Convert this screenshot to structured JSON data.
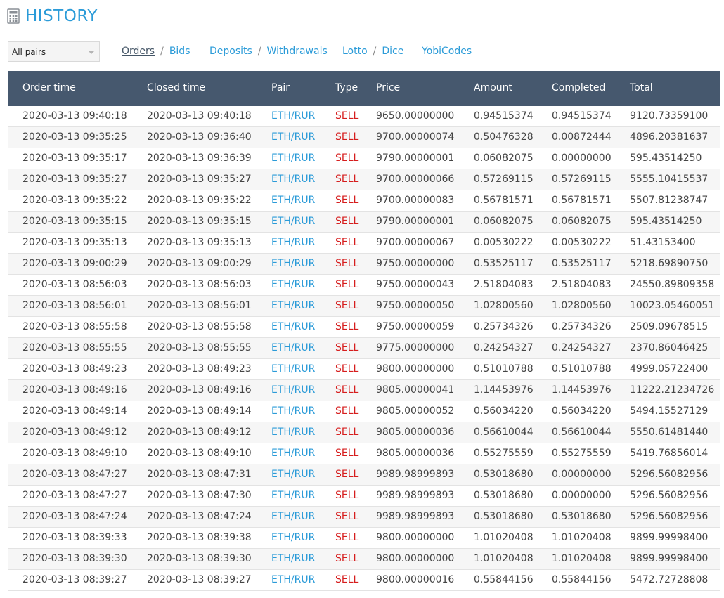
{
  "header": {
    "title": "HISTORY",
    "icon": "calculator-icon"
  },
  "filters": {
    "pair_select": "All pairs"
  },
  "nav": {
    "orders": "Orders",
    "bids": "Bids",
    "deposits": "Deposits",
    "withdrawals": "Withdrawals",
    "lotto": "Lotto",
    "dice": "Dice",
    "yobicodes": "YobiCodes",
    "separator": "/"
  },
  "columns": [
    "Order time",
    "Closed time",
    "Pair",
    "Type",
    "Price",
    "Amount",
    "Completed",
    "Total"
  ],
  "rows": [
    [
      "2020-03-13 09:40:18",
      "2020-03-13 09:40:18",
      "ETH/RUR",
      "SELL",
      "9650.00000000",
      "0.94515374",
      "0.94515374",
      "9120.73359100"
    ],
    [
      "2020-03-13 09:35:25",
      "2020-03-13 09:36:40",
      "ETH/RUR",
      "SELL",
      "9700.00000074",
      "0.50476328",
      "0.00872444",
      "4896.20381637"
    ],
    [
      "2020-03-13 09:35:17",
      "2020-03-13 09:36:39",
      "ETH/RUR",
      "SELL",
      "9790.00000001",
      "0.06082075",
      "0.00000000",
      "595.43514250"
    ],
    [
      "2020-03-13 09:35:27",
      "2020-03-13 09:35:27",
      "ETH/RUR",
      "SELL",
      "9700.00000066",
      "0.57269115",
      "0.57269115",
      "5555.10415537"
    ],
    [
      "2020-03-13 09:35:22",
      "2020-03-13 09:35:22",
      "ETH/RUR",
      "SELL",
      "9700.00000083",
      "0.56781571",
      "0.56781571",
      "5507.81238747"
    ],
    [
      "2020-03-13 09:35:15",
      "2020-03-13 09:35:15",
      "ETH/RUR",
      "SELL",
      "9790.00000001",
      "0.06082075",
      "0.06082075",
      "595.43514250"
    ],
    [
      "2020-03-13 09:35:13",
      "2020-03-13 09:35:13",
      "ETH/RUR",
      "SELL",
      "9700.00000067",
      "0.00530222",
      "0.00530222",
      "51.43153400"
    ],
    [
      "2020-03-13 09:00:29",
      "2020-03-13 09:00:29",
      "ETH/RUR",
      "SELL",
      "9750.00000000",
      "0.53525117",
      "0.53525117",
      "5218.69890750"
    ],
    [
      "2020-03-13 08:56:03",
      "2020-03-13 08:56:03",
      "ETH/RUR",
      "SELL",
      "9750.00000043",
      "2.51804083",
      "2.51804083",
      "24550.89809358"
    ],
    [
      "2020-03-13 08:56:01",
      "2020-03-13 08:56:01",
      "ETH/RUR",
      "SELL",
      "9750.00000050",
      "1.02800560",
      "1.02800560",
      "10023.05460051"
    ],
    [
      "2020-03-13 08:55:58",
      "2020-03-13 08:55:58",
      "ETH/RUR",
      "SELL",
      "9750.00000059",
      "0.25734326",
      "0.25734326",
      "2509.09678515"
    ],
    [
      "2020-03-13 08:55:55",
      "2020-03-13 08:55:55",
      "ETH/RUR",
      "SELL",
      "9775.00000000",
      "0.24254327",
      "0.24254327",
      "2370.86046425"
    ],
    [
      "2020-03-13 08:49:23",
      "2020-03-13 08:49:23",
      "ETH/RUR",
      "SELL",
      "9800.00000000",
      "0.51010788",
      "0.51010788",
      "4999.05722400"
    ],
    [
      "2020-03-13 08:49:16",
      "2020-03-13 08:49:16",
      "ETH/RUR",
      "SELL",
      "9805.00000041",
      "1.14453976",
      "1.14453976",
      "11222.21234726"
    ],
    [
      "2020-03-13 08:49:14",
      "2020-03-13 08:49:14",
      "ETH/RUR",
      "SELL",
      "9805.00000052",
      "0.56034220",
      "0.56034220",
      "5494.15527129"
    ],
    [
      "2020-03-13 08:49:12",
      "2020-03-13 08:49:12",
      "ETH/RUR",
      "SELL",
      "9805.00000036",
      "0.56610044",
      "0.56610044",
      "5550.61481440"
    ],
    [
      "2020-03-13 08:49:10",
      "2020-03-13 08:49:10",
      "ETH/RUR",
      "SELL",
      "9805.00000036",
      "0.55275559",
      "0.55275559",
      "5419.76856014"
    ],
    [
      "2020-03-13 08:47:27",
      "2020-03-13 08:47:31",
      "ETH/RUR",
      "SELL",
      "9989.98999893",
      "0.53018680",
      "0.00000000",
      "5296.56082956"
    ],
    [
      "2020-03-13 08:47:27",
      "2020-03-13 08:47:30",
      "ETH/RUR",
      "SELL",
      "9989.98999893",
      "0.53018680",
      "0.00000000",
      "5296.56082956"
    ],
    [
      "2020-03-13 08:47:24",
      "2020-03-13 08:47:24",
      "ETH/RUR",
      "SELL",
      "9989.98999893",
      "0.53018680",
      "0.53018680",
      "5296.56082956"
    ],
    [
      "2020-03-13 08:39:33",
      "2020-03-13 08:39:38",
      "ETH/RUR",
      "SELL",
      "9800.00000000",
      "1.01020408",
      "1.01020408",
      "9899.99998400"
    ],
    [
      "2020-03-13 08:39:30",
      "2020-03-13 08:39:30",
      "ETH/RUR",
      "SELL",
      "9800.00000000",
      "1.01020408",
      "1.01020408",
      "9899.99998400"
    ],
    [
      "2020-03-13 08:39:27",
      "2020-03-13 08:39:27",
      "ETH/RUR",
      "SELL",
      "9800.00000016",
      "0.55844156",
      "0.55844156",
      "5472.72728808"
    ]
  ]
}
